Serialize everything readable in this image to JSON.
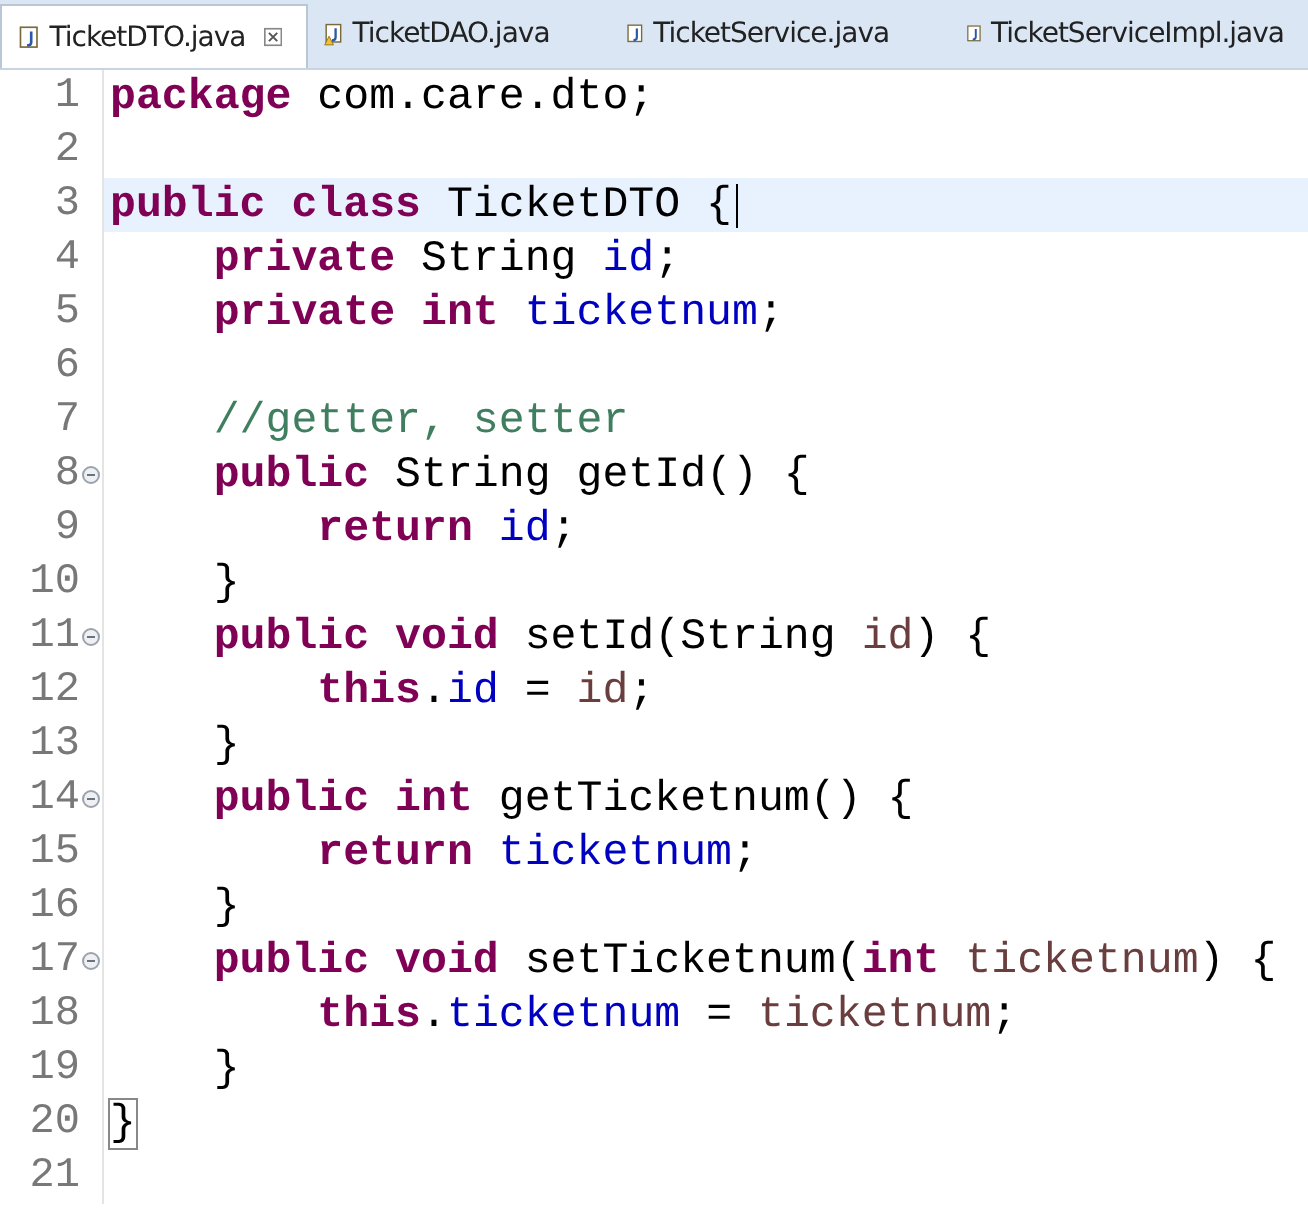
{
  "tabs": [
    {
      "label": "TicketDTO.java",
      "selected": true,
      "warning": false
    },
    {
      "label": "TicketDAO.java",
      "selected": false,
      "warning": true
    },
    {
      "label": "TicketService.java",
      "selected": false,
      "warning": false
    },
    {
      "label": "TicketServiceImpl.java",
      "selected": false,
      "warning": false
    }
  ],
  "editor": {
    "lines": [
      {
        "number": "1",
        "fold": false,
        "current": false,
        "segments": [
          {
            "text": "package",
            "kind": "keyword"
          },
          {
            "text": " com.care.dto;",
            "kind": "plain"
          }
        ]
      },
      {
        "number": "2",
        "fold": false,
        "current": false
      },
      {
        "number": "3",
        "fold": false,
        "current": true,
        "segments": [
          {
            "text": "public class",
            "kind": "keyword"
          },
          {
            "text": " TicketDTO {",
            "kind": "plain"
          }
        ]
      },
      {
        "number": "4",
        "fold": false,
        "current": false,
        "segments": [
          {
            "text": "    private",
            "kind": "keyword"
          },
          {
            "text": " String ",
            "kind": "plain"
          },
          {
            "text": "id",
            "kind": "field"
          },
          {
            "text": ";",
            "kind": "plain"
          }
        ]
      },
      {
        "number": "5",
        "fold": false,
        "current": false,
        "segments": [
          {
            "text": "    private int",
            "kind": "keyword"
          },
          {
            "text": " ticketnum",
            "kind": "field"
          },
          {
            "text": ";",
            "kind": "plain"
          }
        ]
      },
      {
        "number": "6",
        "fold": false,
        "current": false
      },
      {
        "number": "7",
        "fold": false,
        "current": false,
        "segments": [
          {
            "text": "    //getter, setter",
            "kind": "comment"
          }
        ]
      },
      {
        "number": "8",
        "fold": true,
        "current": false,
        "segments": [
          {
            "text": "    public",
            "kind": "keyword"
          },
          {
            "text": " String getId() {",
            "kind": "plain"
          }
        ]
      },
      {
        "number": "9",
        "fold": false,
        "current": false,
        "segments": [
          {
            "text": "        return",
            "kind": "keyword"
          },
          {
            "text": " id",
            "kind": "field"
          },
          {
            "text": ";",
            "kind": "plain"
          }
        ]
      },
      {
        "number": "10",
        "fold": false,
        "current": false,
        "segments": [
          {
            "text": "    }",
            "kind": "plain"
          }
        ]
      },
      {
        "number": "11",
        "fold": true,
        "current": false,
        "segments": [
          {
            "text": "    public void",
            "kind": "keyword"
          },
          {
            "text": " setId(String ",
            "kind": "plain"
          },
          {
            "text": "id",
            "kind": "local"
          },
          {
            "text": ") {",
            "kind": "plain"
          }
        ]
      },
      {
        "number": "12",
        "fold": false,
        "current": false,
        "segments": [
          {
            "text": "        this",
            "kind": "keyword"
          },
          {
            "text": ".",
            "kind": "plain"
          },
          {
            "text": "id",
            "kind": "field"
          },
          {
            "text": " = ",
            "kind": "plain"
          },
          {
            "text": "id",
            "kind": "local"
          },
          {
            "text": ";",
            "kind": "plain"
          }
        ]
      },
      {
        "number": "13",
        "fold": false,
        "current": false,
        "segments": [
          {
            "text": "    }",
            "kind": "plain"
          }
        ]
      },
      {
        "number": "14",
        "fold": true,
        "current": false,
        "segments": [
          {
            "text": "    public int",
            "kind": "keyword"
          },
          {
            "text": " getTicketnum() {",
            "kind": "plain"
          }
        ]
      },
      {
        "number": "15",
        "fold": false,
        "current": false,
        "segments": [
          {
            "text": "        return",
            "kind": "keyword"
          },
          {
            "text": " ticketnum",
            "kind": "field"
          },
          {
            "text": ";",
            "kind": "plain"
          }
        ]
      },
      {
        "number": "16",
        "fold": false,
        "current": false,
        "segments": [
          {
            "text": "    }",
            "kind": "plain"
          }
        ]
      },
      {
        "number": "17",
        "fold": true,
        "current": false,
        "segments": [
          {
            "text": "    public void",
            "kind": "keyword"
          },
          {
            "text": " setTicketnum(",
            "kind": "plain"
          },
          {
            "text": "int",
            "kind": "keyword"
          },
          {
            "text": " ticketnum",
            "kind": "local"
          },
          {
            "text": ") {",
            "kind": "plain"
          }
        ]
      },
      {
        "number": "18",
        "fold": false,
        "current": false,
        "segments": [
          {
            "text": "        this",
            "kind": "keyword"
          },
          {
            "text": ".",
            "kind": "plain"
          },
          {
            "text": "ticketnum",
            "kind": "field"
          },
          {
            "text": " = ",
            "kind": "plain"
          },
          {
            "text": "ticketnum",
            "kind": "local"
          },
          {
            "text": ";",
            "kind": "plain"
          }
        ]
      },
      {
        "number": "19",
        "fold": false,
        "current": false,
        "segments": [
          {
            "text": "    }",
            "kind": "plain"
          }
        ]
      },
      {
        "number": "20",
        "fold": false,
        "current": false,
        "segments": [
          {
            "text": "}",
            "kind": "matched_bracket"
          }
        ]
      },
      {
        "number": "21",
        "fold": false,
        "current": false
      }
    ]
  }
}
